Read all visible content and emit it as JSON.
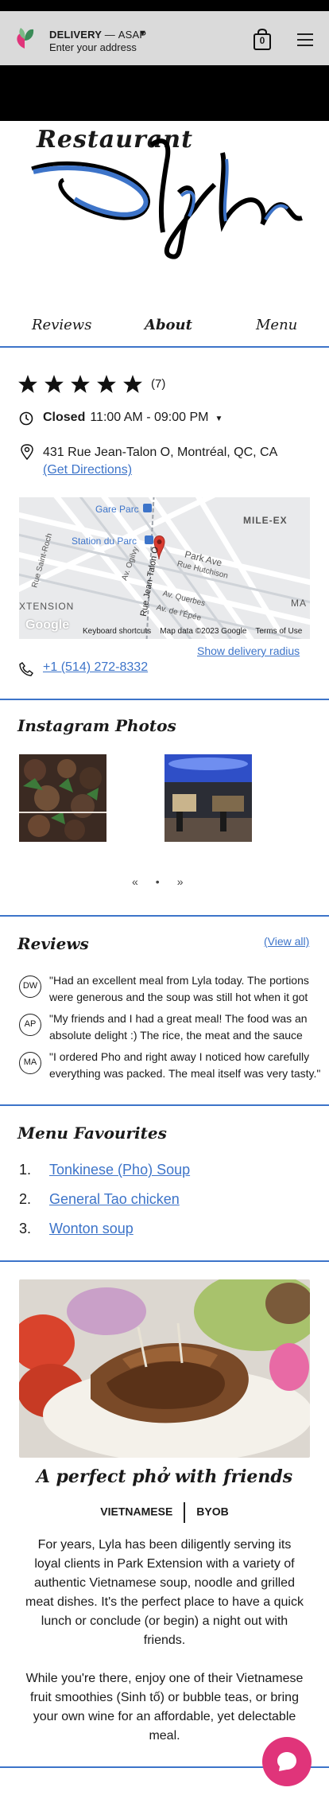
{
  "header": {
    "delivery_label": "DELIVERY",
    "delivery_sep": "—",
    "delivery_time": "ASAP",
    "address_placeholder": "Enter your address",
    "cart_count": "0"
  },
  "logo": {
    "restaurant": "Restaurant",
    "name": "Lyla"
  },
  "nav": {
    "items": [
      {
        "label": "Reviews"
      },
      {
        "label": "About"
      },
      {
        "label": "Menu"
      }
    ]
  },
  "info": {
    "rating_stars": 5,
    "review_count": "(7)",
    "status": "Closed",
    "hours": "11:00 AM - 09:00 PM",
    "address": "431 Rue Jean-Talon O, Montréal, QC, CA",
    "directions": "(Get Directions)",
    "delivery_radius": "Show delivery radius",
    "phone": "+1 (514) 272-8332"
  },
  "map": {
    "labels": [
      "Gare Parc",
      "Station du Parc",
      "MILE-EX",
      "Park Ave",
      "Rue Hutchison",
      "Av. Ogilvy",
      "Rue Saint-Roch",
      "XTENSION",
      "Av. Querbes",
      "Av. de l'Épée",
      "Rue Jean-Talon O",
      "MA"
    ],
    "google": "Google",
    "footer": [
      "Keyboard shortcuts",
      "Map data ©2023 Google",
      "Terms of Use"
    ]
  },
  "instagram": {
    "title": "Instagram Photos",
    "pager": [
      "«",
      "•",
      "»"
    ]
  },
  "reviews": {
    "title": "Reviews",
    "view_all": "(View all)",
    "items": [
      {
        "initials": "DW",
        "text": "\"Had an excellent meal from Lyla today. The portions were generous and the soup was still hot when it got here.\""
      },
      {
        "initials": "AP",
        "text": "\"My friends and I had a great meal! The food was an absolute delight :) The rice, the meat and the sauce were all so good.\""
      },
      {
        "initials": "MA",
        "text": "\"I ordered Pho and right away I noticed how carefully everything was packed. The meal itself was very tasty.\""
      }
    ]
  },
  "favourites": {
    "title": "Menu Favourites",
    "items": [
      {
        "num": "1.",
        "label": "Tonkinese (Pho) Soup"
      },
      {
        "num": "2.",
        "label": "General Tao chicken"
      },
      {
        "num": "3.",
        "label": "Wonton soup"
      }
    ]
  },
  "about": {
    "heading": "A perfect phở with friends",
    "tags": [
      "VIETNAMESE",
      "BYOB"
    ],
    "paragraph1": "For years, Lyla has been diligently serving its loyal clients in Park Extension with a variety of authentic Vietnamese soup, noodle and grilled meat dishes. It's the perfect place to have a quick lunch or conclude (or begin) a night out with friends.",
    "paragraph2": "While you're there, enjoy one of their Vietnamese fruit smoothies (Sinh tố) or bubble teas, or bring your own wine for an affordable, yet delectable meal."
  },
  "colors": {
    "accent": "#3d74c9",
    "chat": "#e0347a"
  }
}
